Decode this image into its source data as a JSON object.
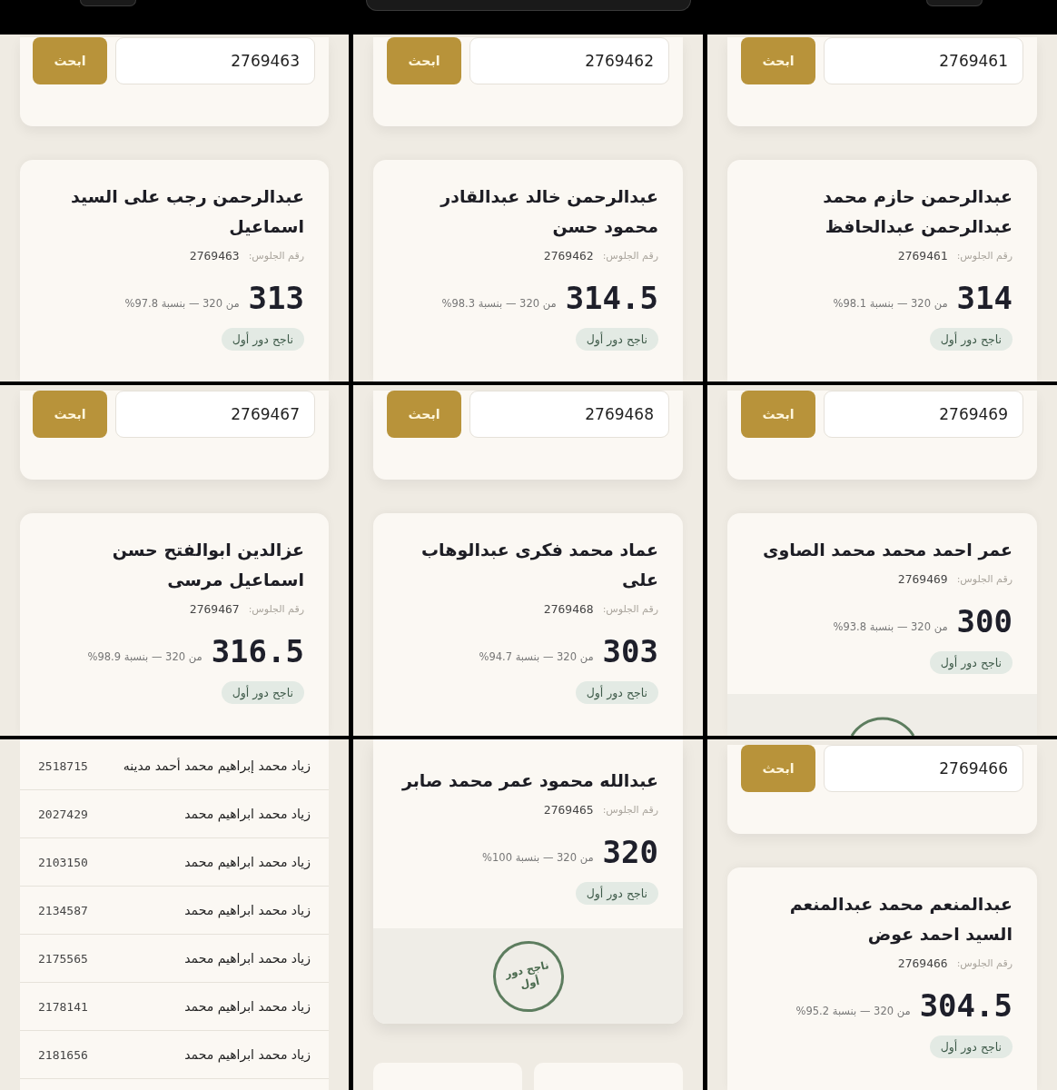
{
  "panels": [
    {
      "kind": "search",
      "search": {
        "value": "2769461",
        "button": "ابحث"
      },
      "result": {
        "name": "عبدالرحمن حازم محمد عبدالرحمن عبدالحافظ",
        "seat_label": "رقم الجلوس:",
        "seat_number": "2769461",
        "score": "314",
        "details": "من 320 — بنسبة 98.1%",
        "status": "ناجح دور أول"
      }
    },
    {
      "kind": "search",
      "search": {
        "value": "2769462",
        "button": "ابحث"
      },
      "result": {
        "name": "عبدالرحمن خالد عبدالقادر محمود حسن",
        "seat_label": "رقم الجلوس:",
        "seat_number": "2769462",
        "score": "314.5",
        "details": "من 320 — بنسبة 98.3%",
        "status": "ناجح دور أول"
      }
    },
    {
      "kind": "search",
      "search": {
        "value": "2769463",
        "button": "ابحث"
      },
      "result": {
        "name": "عبدالرحمن رجب على السيد اسماعيل",
        "seat_label": "رقم الجلوس:",
        "seat_number": "2769463",
        "score": "313",
        "details": "من 320 — بنسبة 97.8%",
        "status": "ناجح دور أول"
      }
    },
    {
      "kind": "search",
      "search": {
        "value": "2769469",
        "button": "ابحث"
      },
      "result": {
        "name": "عمر احمد محمد محمد الصاوى",
        "seat_label": "رقم الجلوس:",
        "seat_number": "2769469",
        "score": "300",
        "details": "من 320 — بنسبة 93.8%",
        "status": "ناجح دور أول",
        "stamp": {
          "kind": "cut"
        }
      }
    },
    {
      "kind": "search",
      "search": {
        "value": "2769468",
        "button": "ابحث"
      },
      "result": {
        "name": "عماد محمد فكرى عبدالوهاب على",
        "seat_label": "رقم الجلوس:",
        "seat_number": "2769468",
        "score": "303",
        "details": "من 320 — بنسبة 94.7%",
        "status": "ناجح دور أول"
      }
    },
    {
      "kind": "search",
      "search": {
        "value": "2769467",
        "button": "ابحث"
      },
      "result": {
        "name": "عزالدين ابوالفتح حسن اسماعيل مرسى",
        "seat_label": "رقم الجلوس:",
        "seat_number": "2769467",
        "score": "316.5",
        "details": "من 320 — بنسبة 98.9%",
        "status": "ناجح دور أول"
      }
    },
    {
      "kind": "search",
      "search": {
        "value": "2769466",
        "button": "ابحث"
      },
      "result": {
        "name": "عبدالمنعم محمد عبدالمنعم السيد احمد عوض",
        "seat_label": "رقم الجلوس:",
        "seat_number": "2769466",
        "score": "304.5",
        "details": "من 320 — بنسبة 95.2%",
        "status": "ناجح دور أول"
      }
    },
    {
      "kind": "result",
      "result": {
        "name": "عبدالله محمود عمر محمد صابر",
        "seat_label": "رقم الجلوس:",
        "seat_number": "2769465",
        "score": "320",
        "details": "من 320 — بنسبة 100%",
        "status": "ناجح دور أول",
        "stamp": {
          "kind": "full",
          "text": "ناجح دور أول"
        }
      },
      "tiles": [
        {
          "kind": "card"
        },
        {
          "kind": "card"
        }
      ]
    },
    {
      "kind": "list",
      "rows": [
        {
          "name": "زياد محمد إبراهيم محمد أحمد مدينه",
          "number": "2518715"
        },
        {
          "name": "زياد محمد ابراهيم محمد",
          "number": "2027429"
        },
        {
          "name": "زياد محمد ابراهيم محمد",
          "number": "2103150"
        },
        {
          "name": "زياد محمد ابراهيم محمد",
          "number": "2134587"
        },
        {
          "name": "زياد محمد ابراهيم محمد",
          "number": "2175565"
        },
        {
          "name": "زياد محمد ابراهيم محمد",
          "number": "2178141"
        },
        {
          "name": "زياد محمد ابراهيم محمد",
          "number": "2181656"
        }
      ]
    }
  ]
}
